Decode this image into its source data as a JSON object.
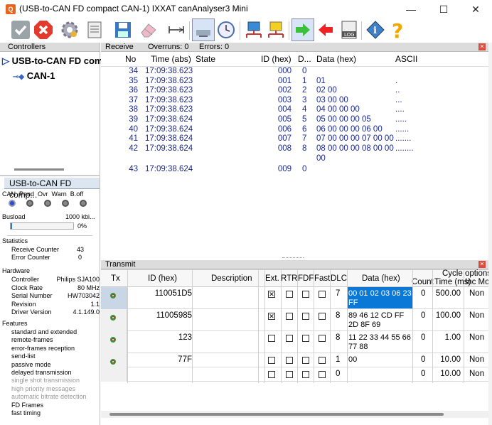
{
  "window": {
    "title": "(USB-to-CAN FD compact  CAN-1) IXXAT canAnalyser3 Mini",
    "minimize": "—",
    "maximize": "☐",
    "close": "✕"
  },
  "toolbar": {
    "icons": [
      "check-icon",
      "stop-icon",
      "settings-icon",
      "config-icon",
      "save-icon",
      "eraser-icon",
      "scale-icon",
      "screen-icon",
      "clock-icon",
      "network-icon",
      "network-yellow-icon",
      "arrow-right-icon",
      "arrow-left-icon",
      "log-icon",
      "info-icon",
      "help-icon"
    ]
  },
  "controllers": {
    "header": "Controllers",
    "device": "USB-to-CAN FD compa",
    "channel": "CAN-1"
  },
  "controller_panel": {
    "header": "USB-to-CAN FD comp...",
    "status_labels": [
      "CAN",
      "Pend",
      "Ovr",
      "Warn",
      "B.off"
    ],
    "busload_label": "Busload",
    "busload_rate": "1000 kbi...",
    "busload_percent": "0%",
    "busload_fraction": 0.0,
    "statistics_label": "Statistics",
    "receive_counter_label": "Receive Counter",
    "receive_counter": "43",
    "error_counter_label": "Error Counter",
    "error_counter": "0",
    "hardware_label": "Hardware",
    "hardware": [
      {
        "k": "Controller",
        "v": "Philips SJA100"
      },
      {
        "k": "Clock Rate",
        "v": "80 MHz"
      },
      {
        "k": "Serial Number",
        "v": "HW703042"
      },
      {
        "k": "Revision",
        "v": "1.1"
      },
      {
        "k": "Driver Version",
        "v": "4.1.149.0"
      }
    ],
    "features_label": "Features",
    "features": [
      {
        "t": "standard and extended",
        "on": true
      },
      {
        "t": "remote-frames",
        "on": true
      },
      {
        "t": "error-frames reception",
        "on": true
      },
      {
        "t": "send-list",
        "on": true
      },
      {
        "t": "passive mode",
        "on": true
      },
      {
        "t": "delayed transmission",
        "on": true
      },
      {
        "t": "single shot transmission",
        "on": false
      },
      {
        "t": "high priority messages",
        "on": false
      },
      {
        "t": "automatic bitrate detection",
        "on": false
      },
      {
        "t": "FD Frames",
        "on": true
      },
      {
        "t": "fast timing",
        "on": true
      }
    ]
  },
  "receive": {
    "tab": "Receive",
    "overruns": "Overruns: 0",
    "errors": "Errors: 0",
    "columns": [
      "No",
      "Time (abs)",
      "State",
      "ID (hex)",
      "D...",
      "Data (hex)",
      "ASCII"
    ],
    "rows": [
      {
        "no": "34",
        "time": "17:09:38.623",
        "id": "000",
        "dlc": "0",
        "data": "",
        "ascii": ""
      },
      {
        "no": "35",
        "time": "17:09:38.623",
        "id": "001",
        "dlc": "1",
        "data": "01",
        "ascii": "."
      },
      {
        "no": "36",
        "time": "17:09:38.623",
        "id": "002",
        "dlc": "2",
        "data": "02 00",
        "ascii": ".."
      },
      {
        "no": "37",
        "time": "17:09:38.623",
        "id": "003",
        "dlc": "3",
        "data": "03 00 00",
        "ascii": "..."
      },
      {
        "no": "38",
        "time": "17:09:38.623",
        "id": "004",
        "dlc": "4",
        "data": "04 00 00 00",
        "ascii": "...."
      },
      {
        "no": "39",
        "time": "17:09:38.624",
        "id": "005",
        "dlc": "5",
        "data": "05 00 00 00 05",
        "ascii": "....."
      },
      {
        "no": "40",
        "time": "17:09:38.624",
        "id": "006",
        "dlc": "6",
        "data": "06 00 00 00 06 00",
        "ascii": "......"
      },
      {
        "no": "41",
        "time": "17:09:38.624",
        "id": "007",
        "dlc": "7",
        "data": "07 00 00 00 07 00 00",
        "ascii": "......."
      },
      {
        "no": "42",
        "time": "17:09:38.624",
        "id": "008",
        "dlc": "8",
        "data": "08 00 00 00 08 00 00",
        "data2": "00",
        "ascii": "........"
      },
      {
        "no": "43",
        "time": "17:09:38.624",
        "id": "009",
        "dlc": "0",
        "data": "",
        "ascii": ""
      }
    ]
  },
  "transmit": {
    "tab": "Transmit",
    "cycle_options": "Cycle options",
    "columns": {
      "tx": "Tx",
      "id": "ID (hex)",
      "desc": "Description",
      "ext": "Ext.",
      "rtr": "RTR",
      "fdf": "FDF",
      "fast": "Fast",
      "dlc": "DLC",
      "data": "Data (hex)",
      "count": "Count",
      "time": "Time (ms)",
      "inc": "Inc Mo"
    },
    "rows": [
      {
        "id": "110051D5",
        "ext": true,
        "dlc": "7",
        "data": "00 01 02 03 06 23",
        "data2": "FF",
        "count": "0",
        "time": "500.00",
        "mode": "Non",
        "selected": true
      },
      {
        "id": "11005985",
        "ext": true,
        "dlc": "8",
        "data": "89 46 12 CD FF",
        "data2": "2D 8F 69",
        "count": "0",
        "time": "100.00",
        "mode": "Non",
        "selected": false
      },
      {
        "id": "123",
        "ext": false,
        "dlc": "8",
        "data": "11 22 33 44 55 66",
        "data2": "77 88",
        "count": "0",
        "time": "1.00",
        "mode": "Non",
        "selected": false
      },
      {
        "id": "77F",
        "ext": false,
        "dlc": "1",
        "data": "00",
        "data2": "",
        "count": "0",
        "time": "10.00",
        "mode": "Non",
        "selected": false
      },
      {
        "id": "",
        "ext": false,
        "dlc": "0",
        "data": "",
        "data2": "",
        "count": "0",
        "time": "10.00",
        "mode": "Non",
        "selected": false
      }
    ]
  },
  "colors": {
    "accent": "#0078d7",
    "rx_text": "#1c2a8c",
    "header_bg": "#dcdcdc"
  }
}
